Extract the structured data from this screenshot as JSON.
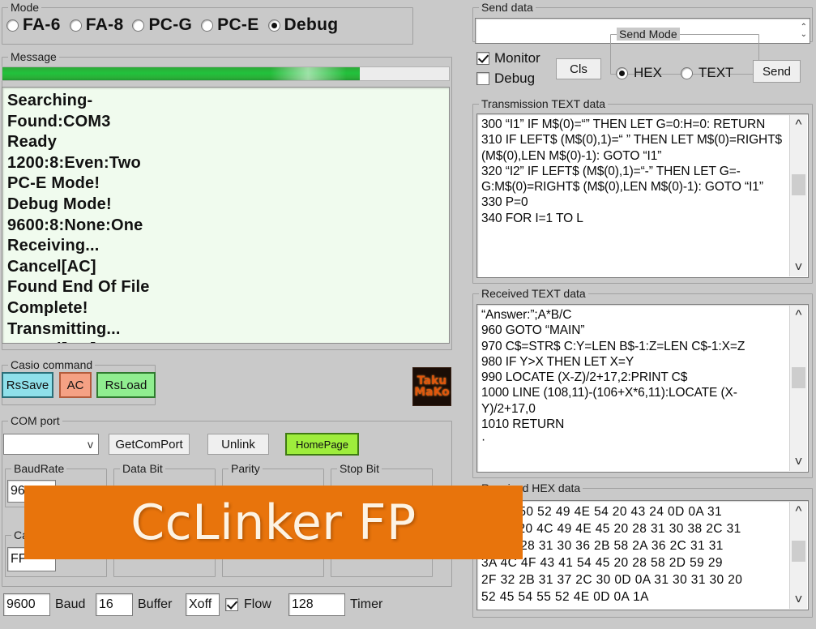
{
  "mode_group": {
    "legend": "Mode",
    "options": [
      {
        "label": "FA-6",
        "selected": false
      },
      {
        "label": "FA-8",
        "selected": false
      },
      {
        "label": "PC-G",
        "selected": false
      },
      {
        "label": "PC-E",
        "selected": false
      },
      {
        "label": "Debug",
        "selected": true
      }
    ]
  },
  "message_group": {
    "legend": "Message",
    "progress_percent": 80,
    "lines": [
      "Searching-",
      "Found:COM3",
      "Ready",
      "1200:8:Even:Two",
      "PC-E Mode!",
      "Debug Mode!",
      "9600:8:None:One",
      "Receiving...",
      "Cancel[AC]",
      "Found End Of File",
      "Complete!",
      "Transmitting...",
      "Cancel[AC]"
    ]
  },
  "casio_command": {
    "legend": "Casio command",
    "buttons": [
      {
        "label": "RsSave",
        "color": "#8fe0ea",
        "border": "#2a6e78"
      },
      {
        "label": "AC",
        "color": "#f5a184",
        "border": "#b35c3c"
      },
      {
        "label": "RsLoad",
        "color": "#90ee90",
        "border": "#2f7a2f"
      }
    ]
  },
  "logo": {
    "line1": "Taku",
    "line2": "MaKo"
  },
  "com_port": {
    "legend": "COM port",
    "port_value": "",
    "port_chevron": "v",
    "buttons": [
      {
        "label": "GetComPort",
        "color": "#efefef",
        "border": "#9e9e9e"
      },
      {
        "label": "Unlink",
        "color": "#efefef",
        "border": "#9e9e9e"
      },
      {
        "label": "HomePage",
        "color": "#9eed3c",
        "border": "#3f7a12"
      }
    ],
    "sub_groups": [
      {
        "legend": "BaudRate",
        "value": "9600"
      },
      {
        "legend": "Data Bit",
        "value": ""
      },
      {
        "legend": "Parity",
        "value": ""
      },
      {
        "legend": "Stop Bit",
        "value": ""
      }
    ],
    "casio_sub": {
      "legend": "Casio",
      "value": "FF"
    }
  },
  "bottom_bar": {
    "baud_value": "9600",
    "baud_label": "Baud",
    "buffer_value": "16",
    "buffer_label": "Buffer",
    "flow_value": "Xoff",
    "flow_label": "Flow",
    "flow_checked": true,
    "timer_value": "128",
    "timer_label": "Timer"
  },
  "send_data": {
    "legend": "Send data",
    "value": "",
    "placeholder": "",
    "spinner_up": "⌃",
    "spinner_down": "⌄"
  },
  "options_row": {
    "monitor_label": "Monitor",
    "monitor_checked": true,
    "debug_label": "Debug",
    "debug_checked": false,
    "cls_label": "Cls",
    "send_mode_legend": "Send Mode",
    "send_modes": [
      {
        "label": "HEX",
        "selected": true
      },
      {
        "label": "TEXT",
        "selected": false
      }
    ],
    "send_label": "Send"
  },
  "transmission_text": {
    "legend": "Transmission TEXT data",
    "content": "300 “I1” IF M$(0)=“” THEN LET G=0:H=0: RETURN\n310 IF LEFT$ (M$(0),1)=“ ” THEN LET M$(0)=RIGHT$ (M$(0),LEN M$(0)-1): GOTO “I1”\n320 “I2” IF LEFT$ (M$(0),1)=“-” THEN LET G=-G:M$(0)=RIGHT$ (M$(0),LEN M$(0)-1): GOTO “I1”\n330 P=0\n340 FOR I=1 TO L"
  },
  "received_text": {
    "legend": "Received TEXT data",
    "content": "“Answer:”;A*B/C\n960 GOTO “MAIN”\n970 C$=STR$ C:Y=LEN B$-1:Z=LEN C$-1:X=Z\n980 IF Y>X THEN LET X=Y\n990 LOCATE (X-Z)/2+17,2:PRINT C$\n1000 LINE (108,11)-(106+X*6,11):LOCATE (X-Y)/2+17,0\n1010 RETURN\n·"
  },
  "received_hex": {
    "legend": "Received HEX data",
    "content": "32 3A 50 52 49 4E 54 20 43 24 0D 0A 31\n30 30 20 4C 49 4E 45 20 28 31 30 38 2C 31\n39 2D 28 31 30 36 2B 58 2A 36 2C 31 31\n3A 4C 4F 43 41 54 45 20 28 58 2D 59 29\n2F 32 2B 31 37 2C 30 0D 0A 31 30 31 30 20\n52 45 54 55 52 4E 0D 0A 1A"
  },
  "splash": {
    "title": "CcLinker FP",
    "color": "#e8740c"
  }
}
